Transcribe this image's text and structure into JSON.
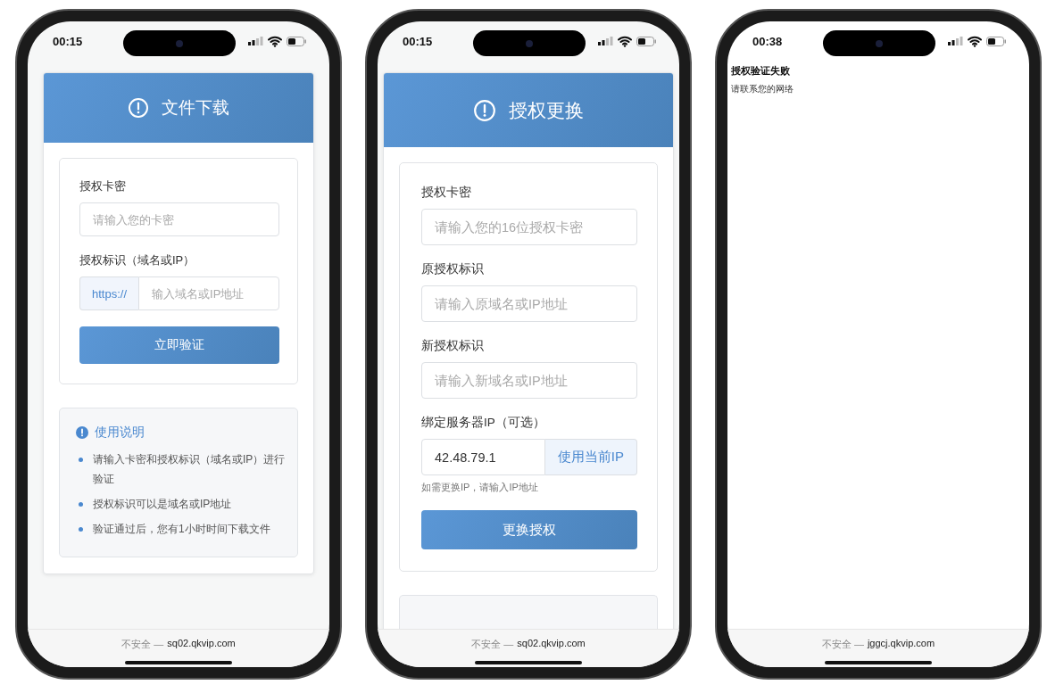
{
  "phones": [
    {
      "time": "00:15",
      "address": {
        "warning": "不安全 —",
        "domain": "sq02.qkvip.com"
      },
      "page": {
        "kind": "download",
        "title": "文件下载",
        "fields": [
          {
            "kind": "text",
            "label": "授权卡密",
            "placeholder": "请输入您的卡密"
          },
          {
            "kind": "prefixed",
            "label": "授权标识（域名或IP）",
            "prefix": "https://",
            "placeholder": "输入域名或IP地址"
          }
        ],
        "submit": "立即验证",
        "info": {
          "title": "使用说明",
          "items": [
            "请输入卡密和授权标识（域名或IP）进行验证",
            "授权标识可以是域名或IP地址",
            "验证通过后，您有1小时时间下载文件"
          ]
        }
      }
    },
    {
      "time": "00:15",
      "address": {
        "warning": "不安全 —",
        "domain": "sq02.qkvip.com"
      },
      "page": {
        "kind": "replace",
        "title": "授权更换",
        "fields": [
          {
            "kind": "text",
            "label": "授权卡密",
            "placeholder": "请输入您的16位授权卡密"
          },
          {
            "kind": "text",
            "label": "原授权标识",
            "placeholder": "请输入原域名或IP地址"
          },
          {
            "kind": "text",
            "label": "新授权标识",
            "placeholder": "请输入新域名或IP地址"
          },
          {
            "kind": "addon",
            "label": "绑定服务器IP（可选）",
            "value": "42.48.79.1",
            "button": "使用当前IP",
            "hint": "如需更换IP，请输入IP地址"
          }
        ],
        "submit": "更换授权",
        "info_peek": true
      }
    },
    {
      "time": "00:38",
      "address": {
        "warning": "不安全 —",
        "domain": "jggcj.qkvip.com"
      },
      "page": {
        "kind": "message",
        "title": "授权验证失败",
        "text": "请联系您的网络"
      }
    }
  ]
}
